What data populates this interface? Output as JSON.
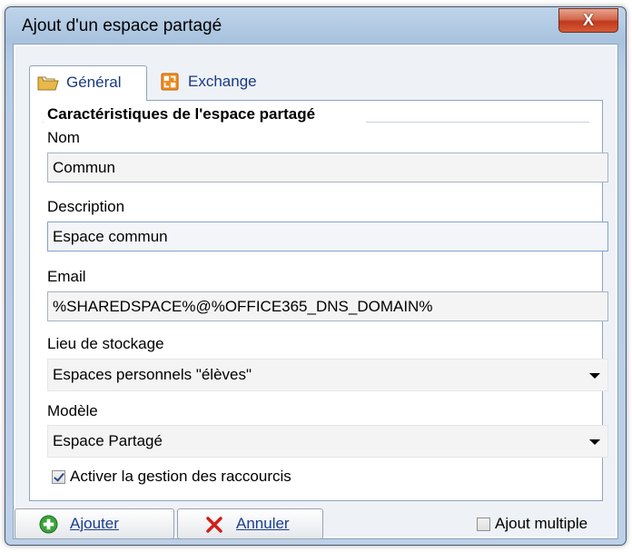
{
  "window": {
    "title": "Ajout d'un espace partagé",
    "close_label": "X"
  },
  "tabs": [
    {
      "label": "Général",
      "icon": "folder-icon",
      "active": true
    },
    {
      "label": "Exchange",
      "icon": "exchange-icon",
      "active": false
    }
  ],
  "section": {
    "title": "Caractéristiques de l'espace partagé"
  },
  "form": {
    "name_label": "Nom",
    "name_value": "Commun",
    "description_label": "Description",
    "description_value": "Espace commun",
    "email_label": "Email",
    "email_value": "%SHAREDSPACE%@%OFFICE365_DNS_DOMAIN%",
    "storage_label": "Lieu de stockage",
    "storage_value": "Espaces personnels \"élèves\"",
    "model_label": "Modèle",
    "model_value": "Espace Partagé",
    "shortcuts_label": "Activer la gestion des raccourcis",
    "shortcuts_checked": true
  },
  "footer": {
    "add_label": "Ajouter",
    "cancel_label": "Annuler",
    "multiple_label": "Ajout multiple",
    "multiple_checked": false
  },
  "colors": {
    "accent": "#1a3a82",
    "add_green": "#3aa23a",
    "cancel_red": "#d0201a"
  }
}
